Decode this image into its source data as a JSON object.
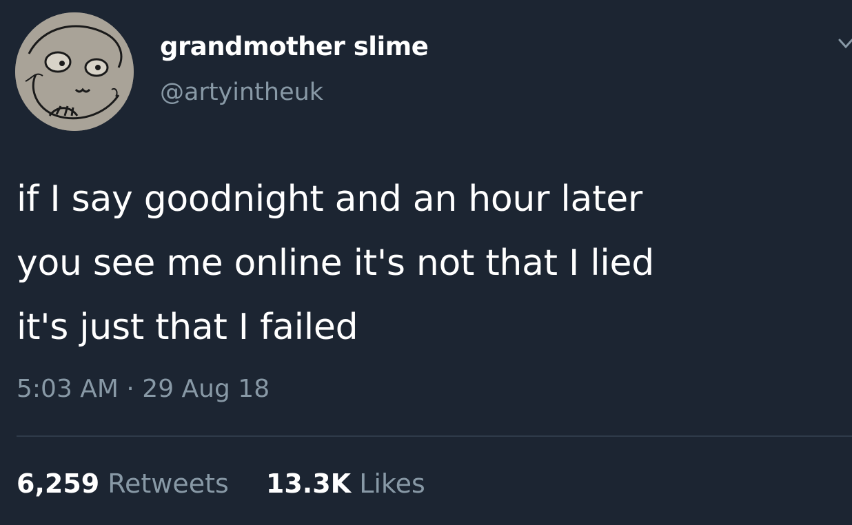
{
  "author": {
    "display_name": "grandmother slime",
    "handle": "@artyintheuk",
    "avatar_icon": "doodle-face-avatar"
  },
  "tweet": {
    "text": "if I say goodnight and an hour later\nyou see me online it's not that I lied\nit's just that I failed",
    "timestamp": "5:03 AM · 29 Aug 18"
  },
  "stats": {
    "retweets_count": "6,259",
    "retweets_label": "Retweets",
    "likes_count": "13.3K",
    "likes_label": "Likes"
  },
  "colors": {
    "background": "#1c2532",
    "primary_text": "#ffffff",
    "secondary_text": "#8899a6",
    "divider": "#2f3b4a"
  },
  "icons": {
    "menu": "chevron-down-icon"
  }
}
